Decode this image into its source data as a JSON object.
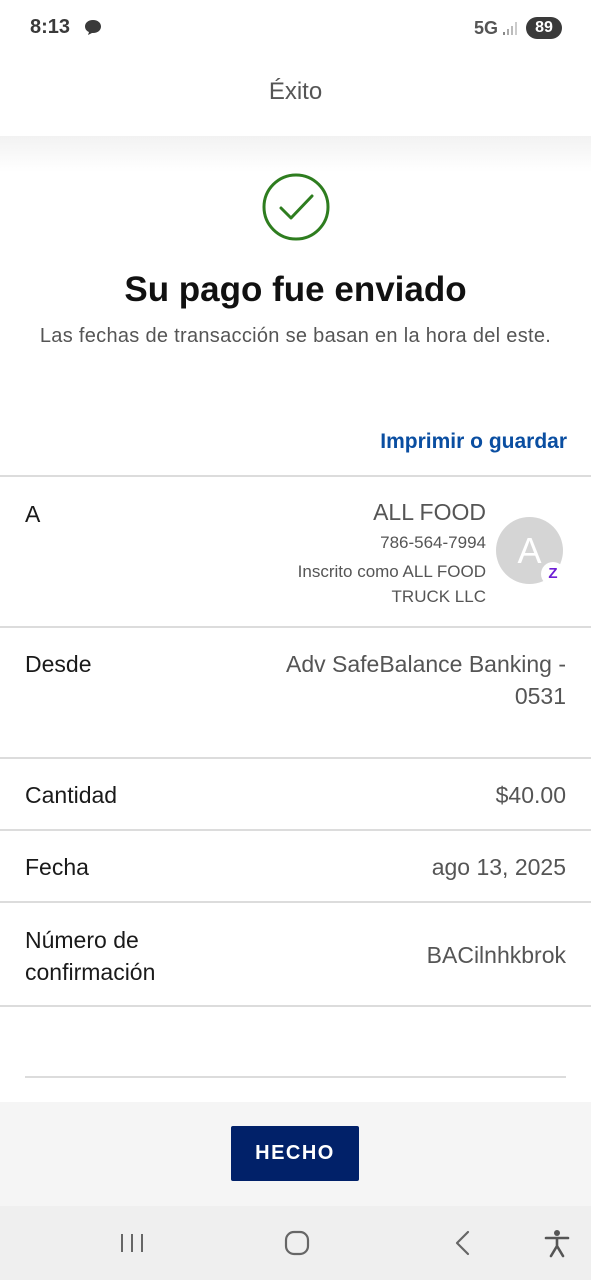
{
  "status_bar": {
    "time": "8:13",
    "network": "5G",
    "battery": "89"
  },
  "header": {
    "title": "Éxito"
  },
  "success": {
    "title": "Su pago fue enviado",
    "subtitle": "Las fechas de transacción se basan en la hora del este.",
    "print_link": "Imprimir o guardar"
  },
  "details": {
    "to": {
      "label": "A",
      "name": "ALL FOOD",
      "phone": "786-564-7994",
      "enrolled": "Inscrito como ALL FOOD TRUCK LLC",
      "avatar_initial": "A",
      "badge": "Z"
    },
    "from": {
      "label": "Desde",
      "value": "Adv SafeBalance Banking - 0531"
    },
    "amount": {
      "label": "Cantidad",
      "value": "$40.00"
    },
    "date": {
      "label": "Fecha",
      "value": "ago 13, 2025"
    },
    "confirmation": {
      "label": "Número de confirmación",
      "value": "BACilnhkbrok"
    }
  },
  "actions": {
    "done_label": "HECHO"
  },
  "colors": {
    "brand_navy": "#012169",
    "link_blue": "#0a4ea1",
    "success_green": "#2e7d1f",
    "zelle_purple": "#6d1ed4"
  },
  "nav_icons": [
    "recent-apps-icon",
    "home-icon",
    "back-icon",
    "accessibility-icon"
  ]
}
